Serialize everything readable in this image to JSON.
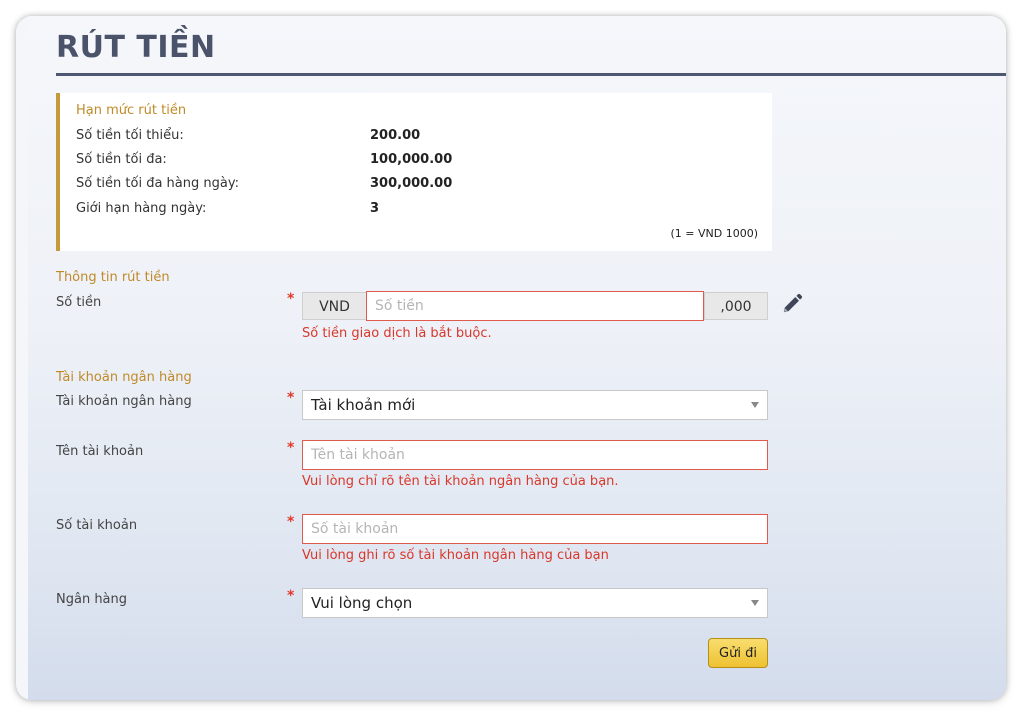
{
  "page": {
    "title": "RÚT TIỀN"
  },
  "limits": {
    "title": "Hạn mức rút tiền",
    "rows": [
      {
        "label": "Số tiền tối thiểu:",
        "value": "200.00"
      },
      {
        "label": "Số tiền tối đa:",
        "value": "100,000.00"
      },
      {
        "label": "Số tiền tối đa hàng ngày:",
        "value": "300,000.00"
      },
      {
        "label": "Giới hạn hàng ngày:",
        "value": "3"
      }
    ],
    "note": "(1 = VND 1000)"
  },
  "withdraw_info": {
    "section_title": "Thông tin rút tiền",
    "amount": {
      "label": "Số tiền",
      "required_mark": "*",
      "currency": "VND",
      "placeholder": "Số tiền",
      "value": "",
      "suffix": ",000",
      "error": "Số tiền giao dịch là bắt buộc.",
      "edit_icon": "pencil-icon"
    }
  },
  "bank_account": {
    "section_title": "Tài khoản ngân hàng",
    "account_select": {
      "label": "Tài khoản ngân hàng",
      "required_mark": "*",
      "selected": "Tài khoản mới"
    },
    "account_name": {
      "label": "Tên tài khoản",
      "required_mark": "*",
      "placeholder": "Tên tài khoản",
      "value": "",
      "error": "Vui lòng chỉ rõ tên tài khoản ngân hàng của bạn."
    },
    "account_number": {
      "label": "Số tài khoản",
      "required_mark": "*",
      "placeholder": "Số tài khoản",
      "value": "",
      "error": "Vui lòng ghi rõ số tài khoản ngân hàng của bạn"
    },
    "bank": {
      "label": "Ngân hàng",
      "required_mark": "*",
      "selected": "Vui lòng chọn"
    }
  },
  "actions": {
    "submit_label": "Gửi đi"
  },
  "colors": {
    "title": "#4a5369",
    "accent_gold": "#c08a28",
    "error_red": "#d9372a",
    "submit_button": "#f2cb45"
  }
}
